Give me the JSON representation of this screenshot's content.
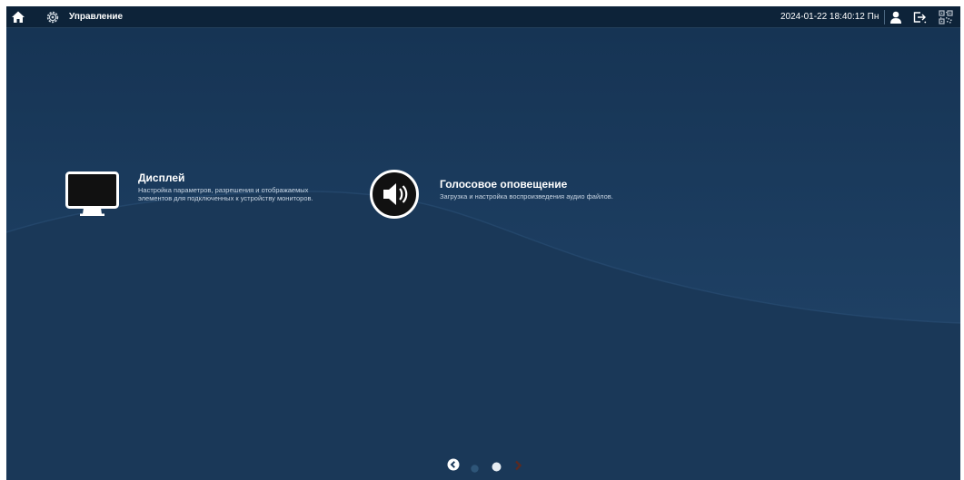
{
  "topbar": {
    "title": "Управление",
    "datetime": "2024-01-22 18:40:12 Пн",
    "icons": {
      "home": "home-icon",
      "settings": "gear-icon",
      "user": "user-icon",
      "logout": "logout-icon",
      "qr": "qr-code-icon"
    }
  },
  "cards": [
    {
      "id": "display",
      "icon": "monitor-icon",
      "title": "Дисплей",
      "description": "Настройка параметров, разрешения и отображаемых элементов для подключенных к устройству мониторов."
    },
    {
      "id": "voice",
      "icon": "speaker-icon",
      "title": "Голосовое оповещение",
      "description": "Загрузка и настройка воспроизведения аудио файлов."
    }
  ],
  "pagination": {
    "pages": 2,
    "current_page": 2
  },
  "colors": {
    "topbar_bg": "#0d2339",
    "main_bg": "#1b3a5b",
    "wave": "#24486e",
    "text": "#ffffff",
    "desc_text": "#c8d5e3",
    "next_arrow_disabled": "#5a2a22"
  }
}
